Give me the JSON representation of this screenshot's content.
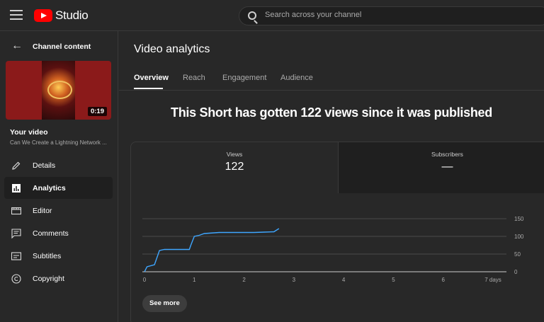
{
  "app": {
    "logo_text": "Studio",
    "search_placeholder": "Search across your channel"
  },
  "sidebar": {
    "back_title": "Channel content",
    "thumbnail_duration": "0:19",
    "your_video_label": "Your video",
    "video_title": "Can We Create a Lightning Network ...",
    "items": [
      {
        "label": "Details",
        "icon": "pencil-icon"
      },
      {
        "label": "Analytics",
        "icon": "analytics-icon",
        "active": true
      },
      {
        "label": "Editor",
        "icon": "film-icon"
      },
      {
        "label": "Comments",
        "icon": "comment-icon"
      },
      {
        "label": "Subtitles",
        "icon": "subtitles-icon"
      },
      {
        "label": "Copyright",
        "icon": "copyright-icon"
      }
    ]
  },
  "main": {
    "title": "Video analytics",
    "tabs": [
      {
        "label": "Overview",
        "active": true
      },
      {
        "label": "Reach"
      },
      {
        "label": "Engagement"
      },
      {
        "label": "Audience"
      }
    ],
    "headline": "This Short has gotten 122 views since it was published",
    "metrics": [
      {
        "label": "Views",
        "value": "122"
      },
      {
        "label": "Subscribers",
        "value": "—"
      }
    ],
    "see_more_label": "See more"
  },
  "colors": {
    "line": "#3ea6ff",
    "background": "#282828",
    "accent_red": "#ff0000"
  },
  "chart_data": {
    "type": "line",
    "x_ticks": [
      "0",
      "1",
      "2",
      "3",
      "4",
      "5",
      "6",
      "7 days"
    ],
    "y_ticks": [
      "0",
      "50",
      "100",
      "150"
    ],
    "xlim": [
      0,
      7
    ],
    "ylim": [
      0,
      150
    ],
    "grid": true,
    "series": [
      {
        "x": [
          0,
          0.05,
          0.2,
          0.25,
          0.3,
          0.4,
          0.5,
          0.9,
          0.93,
          1.0,
          1.1,
          1.2,
          1.5,
          1.8,
          2.2,
          2.4,
          2.6,
          2.7
        ],
        "y": [
          0,
          14,
          20,
          40,
          60,
          63,
          63,
          63,
          75,
          100,
          103,
          108,
          111,
          111,
          111,
          112,
          113,
          122
        ]
      }
    ]
  }
}
